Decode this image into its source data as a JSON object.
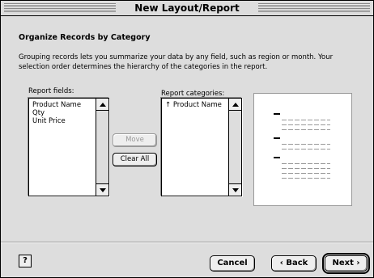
{
  "window": {
    "title": "New Layout/Report"
  },
  "content": {
    "heading": "Organize Records by Category",
    "description": "Grouping records lets you summarize your data by any field, such as region or month.  Your selection order determines the hierarchy of the categories in the report."
  },
  "report_fields": {
    "label": "Report fields:",
    "items": [
      "Product Name",
      "Qty",
      "Unit Price"
    ]
  },
  "report_categories": {
    "label": "Report categories:",
    "items": [
      {
        "marker": "↑",
        "name": "Product Name"
      }
    ]
  },
  "buttons": {
    "move": "Move",
    "clear_all": "Clear All",
    "help": "?",
    "cancel": "Cancel",
    "back": "‹ Back",
    "next": "Next ›"
  }
}
